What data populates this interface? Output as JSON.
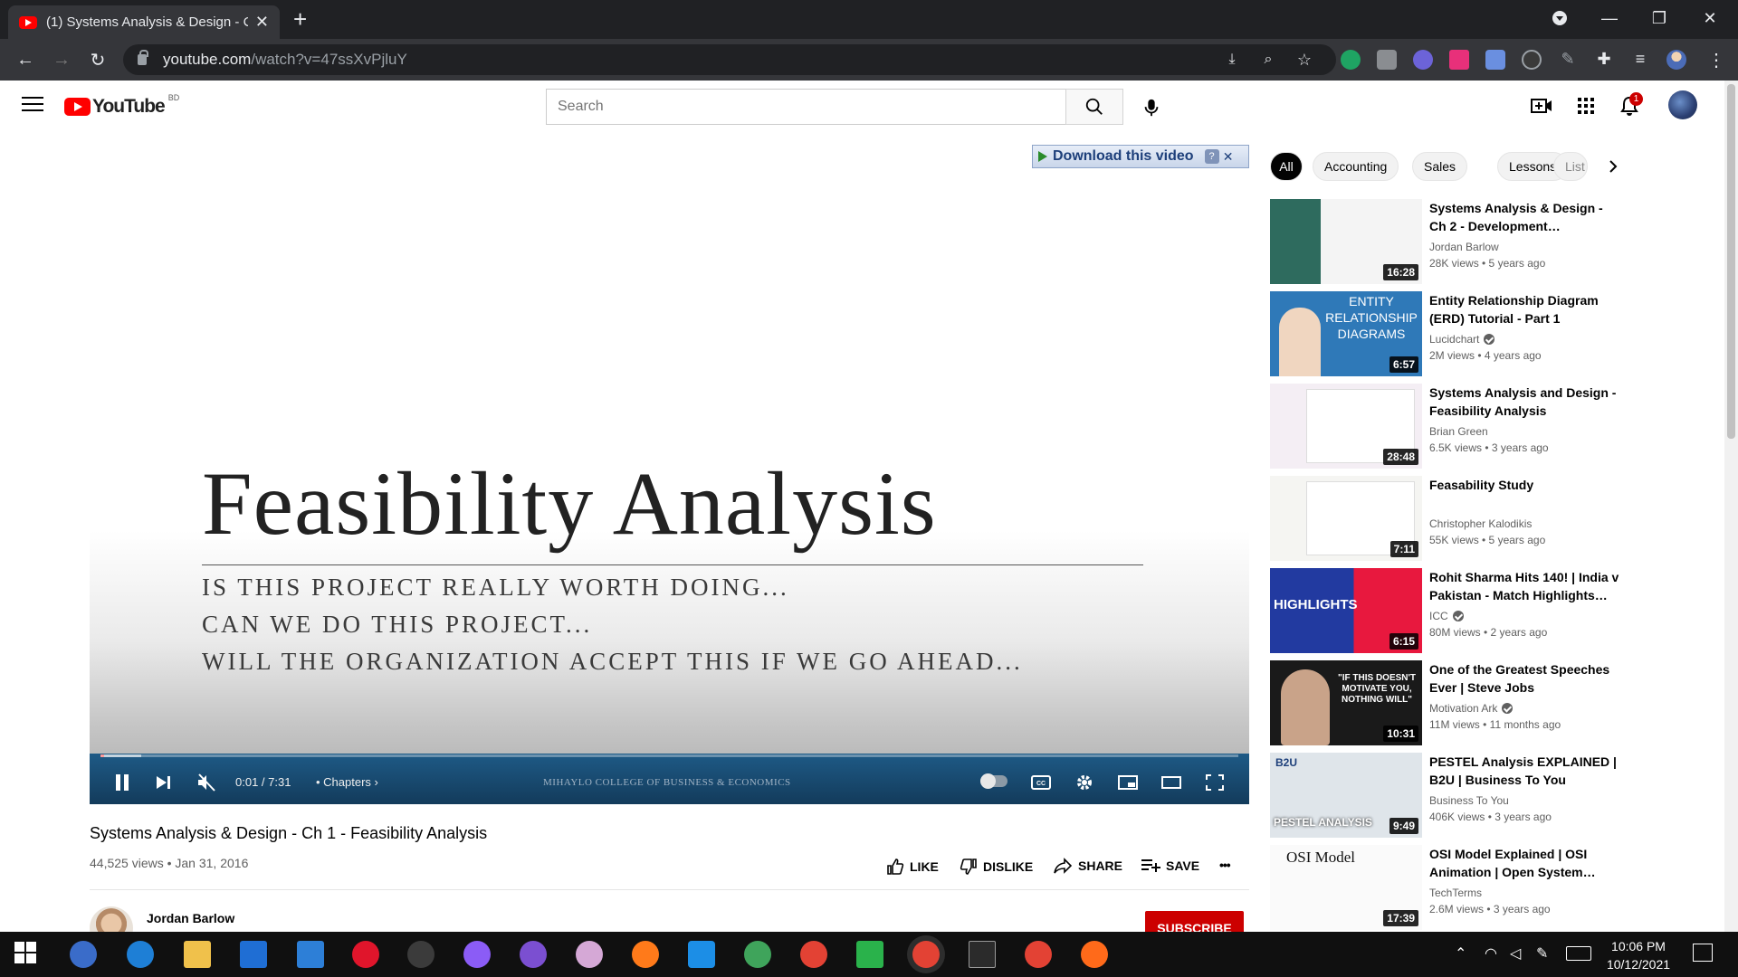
{
  "browser": {
    "tab_title": "(1) Systems Analysis & Design - C",
    "url_host": "youtube.com",
    "url_path": "/watch?v=47ssXvPjluY"
  },
  "youtube": {
    "logo_text": "YouTube",
    "country_code": "BD",
    "search_placeholder": "Search",
    "notification_count": "1"
  },
  "player": {
    "download_banner": "Download this video",
    "download_help": "?",
    "slide_title": "Feasibility Analysis",
    "slide_lines": [
      "IS THIS PROJECT REALLY WORTH DOING...",
      "CAN WE DO THIS PROJECT...",
      "WILL THE ORGANIZATION ACCEPT THIS IF WE GO AHEAD..."
    ],
    "time": "0:01 / 7:31",
    "chapters": "• Chapters",
    "college_watermark": "MIHAYLO COLLEGE OF BUSINESS & ECONOMICS",
    "progress_fraction": 0.002
  },
  "video": {
    "title": "Systems Analysis & Design - Ch 1 - Feasibility Analysis",
    "views_date": "44,525 views • Jan 31, 2016",
    "actions": {
      "like": "LIKE",
      "dislike": "DISLIKE",
      "share": "SHARE",
      "save": "SAVE",
      "more": "•••"
    },
    "channel": "Jordan Barlow",
    "subscribe": "SUBSCRIBE"
  },
  "chips": [
    "All",
    "Accounting",
    "Sales",
    "Lessons",
    "List"
  ],
  "related": [
    {
      "title": "Systems Analysis & Design - Ch 2 - Development…",
      "channel": "Jordan Barlow",
      "verified": false,
      "meta": "28K views • 5 years ago",
      "duration": "16:28",
      "thumb_color": "#2e6b5e"
    },
    {
      "title": "Entity Relationship Diagram (ERD) Tutorial - Part 1",
      "channel": "Lucidchart",
      "verified": true,
      "meta": "2M views • 4 years ago",
      "duration": "6:57",
      "thumb_color": "#2f79b8"
    },
    {
      "title": "Systems Analysis and Design - Feasibility Analysis",
      "channel": "Brian Green",
      "verified": false,
      "meta": "6.5K views • 3 years ago",
      "duration": "28:48",
      "thumb_color": "#f4eef4"
    },
    {
      "title": "Feasability Study",
      "channel": "Christopher Kalodikis",
      "verified": false,
      "meta": "55K views • 5 years ago",
      "duration": "7:11",
      "thumb_color": "#f5f5f2"
    },
    {
      "title": "Rohit Sharma Hits 140! | India v Pakistan - Match Highlights…",
      "channel": "ICC",
      "verified": true,
      "meta": "80M views • 2 years ago",
      "duration": "6:15",
      "thumb_color": "#2a3ea8"
    },
    {
      "title": "One of the Greatest Speeches Ever | Steve Jobs",
      "channel": "Motivation Ark",
      "verified": true,
      "meta": "11M views • 11 months ago",
      "duration": "10:31",
      "thumb_color": "#1a1a1a"
    },
    {
      "title": "PESTEL Analysis EXPLAINED | B2U | Business To You",
      "channel": "Business To You",
      "verified": false,
      "meta": "406K views • 3 years ago",
      "duration": "9:49",
      "thumb_color": "#dfe5ea"
    },
    {
      "title": "OSI Model Explained | OSI Animation | Open System…",
      "channel": "TechTerms",
      "verified": false,
      "meta": "2.6M views • 3 years ago",
      "duration": "17:39",
      "thumb_color": "#fafafa"
    }
  ],
  "related_thumb_text": {
    "erd": "ENTITY RELATIONSHIP DIAGRAMS",
    "highlights": "HIGHLIGHTS",
    "jobs": "\"IF THIS DOESN'T MOTIVATE YOU, NOTHING WILL\"",
    "pestel": "PESTEL ANALYSIS",
    "b2u": "B2U",
    "osi": "OSI Model"
  },
  "taskbar": {
    "time": "10:06 PM",
    "date": "10/12/2021"
  }
}
